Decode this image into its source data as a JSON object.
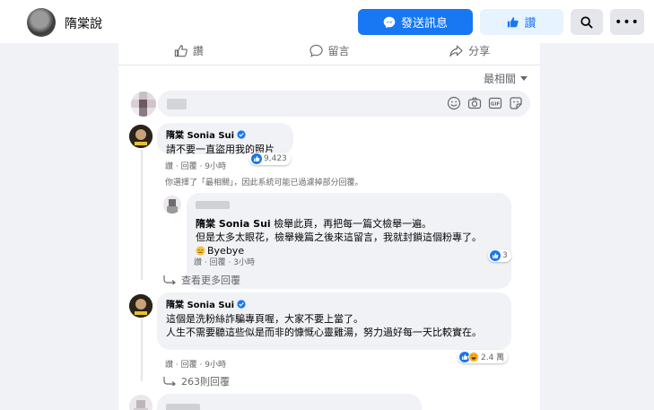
{
  "header": {
    "page_name": "隋棠說",
    "send_message_label": "發送訊息",
    "like_label": "讚"
  },
  "actions": {
    "like": "讚",
    "comment": "留言",
    "share": "分享"
  },
  "sort_label": "最相關",
  "comments": [
    {
      "author": "隋棠 Sonia Sui",
      "text": "請不要一直盜用我的照片",
      "like_action": "讚",
      "reply_action": "回覆",
      "time": "9小時",
      "reaction_count": "9,423"
    },
    {
      "author": "隋棠 Sonia Sui",
      "lines": [
        "這個是洗粉絲詐騙專頁喔，大家不要上當了。",
        "人生不需要聽這些似是而非的慷慨心靈雞湯，努力過好每一天比較實在。"
      ],
      "like_action": "讚",
      "reply_action": "回覆",
      "time": "9小時",
      "reaction_count": "2.4 萬",
      "more_replies": "263則回覆"
    }
  ],
  "filter_note": "你選擇了「最相關」，因此系統可能已過濾掉部分回覆。",
  "reply": {
    "author": "隋棠 Sonia Sui",
    "line1": "檢舉此頁，再把每一篇文檢舉一遍。",
    "line2": "但是太多太眼花，檢舉幾篇之後來這留言，我就封鎖這個粉專了。",
    "bye": "Byebye",
    "like_action": "讚",
    "reply_action": "回覆",
    "time": "3小時",
    "reaction_count": "3"
  },
  "view_more_replies": "查看更多回覆",
  "colors": {
    "primary": "#1877f2",
    "light_primary": "#e7f3ff",
    "secondary_text": "#65676b"
  }
}
